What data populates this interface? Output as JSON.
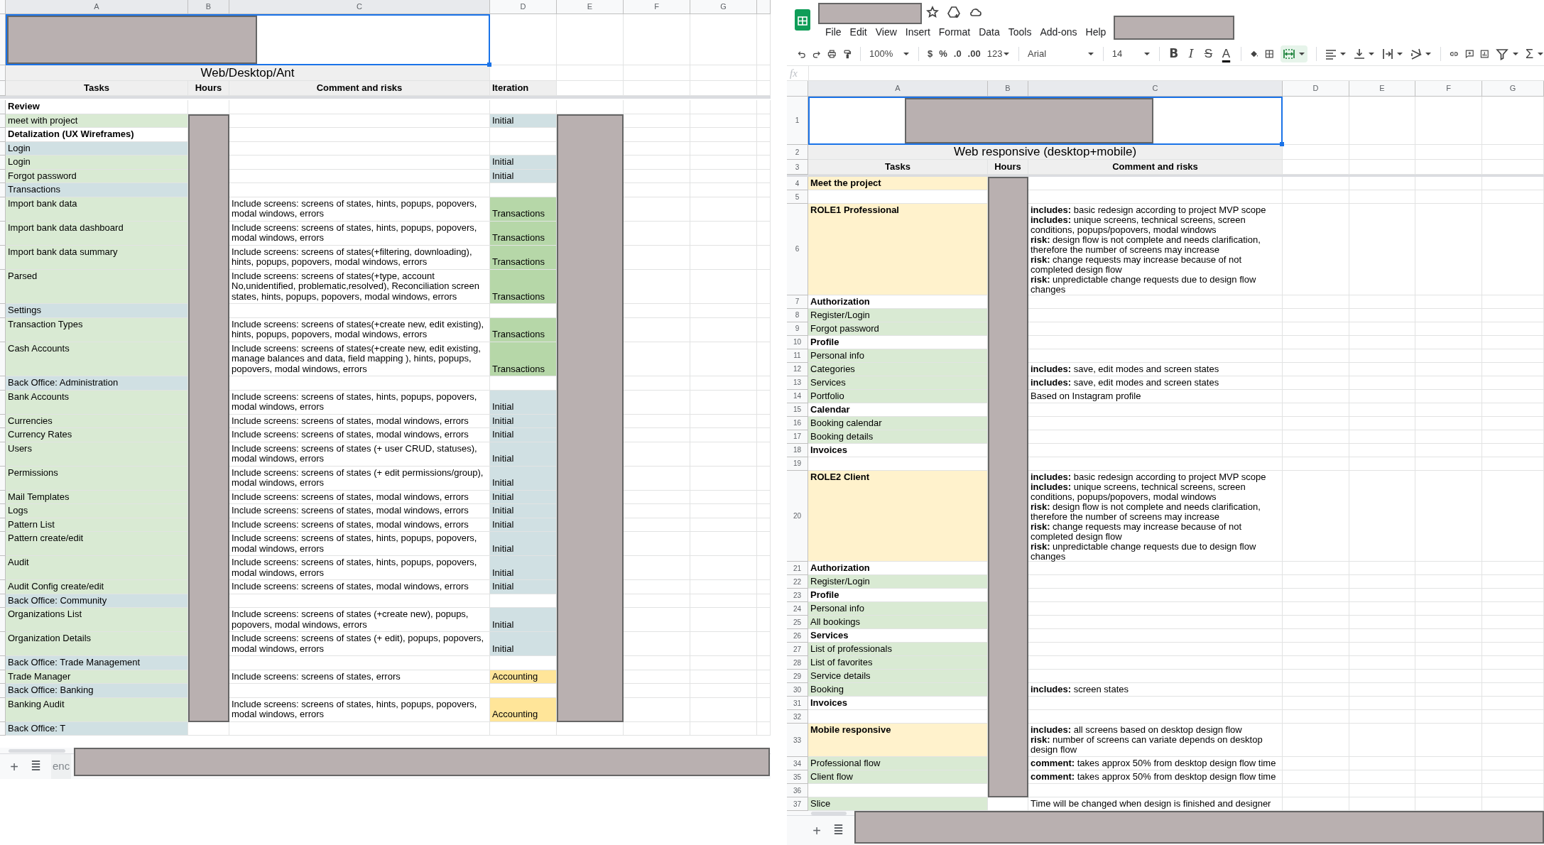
{
  "left_sheet": {
    "column_headers": [
      {
        "label": "A",
        "selected": true
      },
      {
        "label": "B",
        "selected": true
      },
      {
        "label": "C",
        "selected": true
      },
      {
        "label": "D",
        "selected": false
      },
      {
        "label": "E",
        "selected": false
      },
      {
        "label": "F",
        "selected": false
      },
      {
        "label": "G",
        "selected": false
      }
    ],
    "title": "Web/Desktop/Ant",
    "headers": [
      "Tasks",
      "Hours",
      "Comment and risks",
      "Iteration"
    ],
    "rows": [
      {
        "task": "Review",
        "kind": "heading"
      },
      {
        "task": "meet with project",
        "kind": "item",
        "iteration": {
          "label": "Initial",
          "color": "#d0e0e3"
        }
      },
      {
        "task": "Detalization (UX Wireframes)",
        "kind": "heading"
      },
      {
        "task": "Login",
        "kind": "section"
      },
      {
        "task": "Login",
        "kind": "item",
        "iteration": {
          "label": "Initial",
          "color": "#d0e0e3"
        }
      },
      {
        "task": "Forgot password",
        "kind": "item",
        "iteration": {
          "label": "Initial",
          "color": "#d0e0e3"
        }
      },
      {
        "task": "Transactions",
        "kind": "section"
      },
      {
        "task": "Import bank data",
        "kind": "item",
        "comment": "Include screens: screens of states, hints, popups, popovers, modal windows, errors",
        "iteration": {
          "label": "Transactions",
          "color": "#b6d7a8"
        }
      },
      {
        "task": "Import bank data dashboard",
        "kind": "item",
        "comment": "Include screens: screens of states, hints, popups, popovers, modal windows, errors",
        "iteration": {
          "label": "Transactions",
          "color": "#b6d7a8"
        }
      },
      {
        "task": "Import bank data summary",
        "kind": "item",
        "comment": "Include screens: screens of states(+filtering, downloading), hints, popups, popovers, modal windows, errors",
        "iteration": {
          "label": "Transactions",
          "color": "#b6d7a8"
        }
      },
      {
        "task": "Parsed",
        "kind": "item",
        "comment": "Include screens: screens of states(+type, account No,unidentified, problematic,resolved), Reconciliation screen states, hints, popups, popovers, modal windows, errors",
        "iteration": {
          "label": "Transactions",
          "color": "#b6d7a8"
        }
      },
      {
        "task": "Settings",
        "kind": "section"
      },
      {
        "task": "Transaction Types",
        "kind": "item",
        "comment": "Include screens: screens of states(+create new, edit existing), hints, popups, popovers, modal windows, errors",
        "iteration": {
          "label": "Transactions",
          "color": "#b6d7a8"
        }
      },
      {
        "task": "Cash Accounts",
        "kind": "item",
        "comment": "Include screens: screens of states(+create new, edit existing, manage balances and data, field mapping ), hints, popups, popovers, modal windows, errors",
        "iteration": {
          "label": "Transactions",
          "color": "#b6d7a8"
        }
      },
      {
        "task": "Back Office: Administration",
        "kind": "section"
      },
      {
        "task": "Bank Accounts",
        "kind": "item",
        "comment": "Include screens: screens of states, hints, popups, popovers, modal windows, errors",
        "iteration": {
          "label": "Initial",
          "color": "#d0e0e3"
        }
      },
      {
        "task": "Currencies",
        "kind": "item",
        "comment": "Include screens: screens of states, modal windows, errors",
        "iteration": {
          "label": "Initial",
          "color": "#d0e0e3"
        }
      },
      {
        "task": "Currency Rates",
        "kind": "item",
        "comment": "Include screens: screens of states, modal windows, errors",
        "iteration": {
          "label": "Initial",
          "color": "#d0e0e3"
        }
      },
      {
        "task": "Users",
        "kind": "item",
        "comment": "Include screens: screens of states (+ user CRUD, statuses), modal windows, errors",
        "iteration": {
          "label": "Initial",
          "color": "#d0e0e3"
        }
      },
      {
        "task": "Permissions",
        "kind": "item",
        "comment": "Include screens: screens of states (+ edit permissions/group), modal windows, errors",
        "iteration": {
          "label": "Initial",
          "color": "#d0e0e3"
        }
      },
      {
        "task": "Mail Templates",
        "kind": "item",
        "comment": "Include screens: screens of states, modal windows, errors",
        "iteration": {
          "label": "Initial",
          "color": "#d0e0e3"
        }
      },
      {
        "task": "Logs",
        "kind": "item",
        "comment": "Include screens: screens of states, modal windows, errors",
        "iteration": {
          "label": "Initial",
          "color": "#d0e0e3"
        }
      },
      {
        "task": "Pattern List",
        "kind": "item",
        "comment": "Include screens: screens of states, modal windows, errors",
        "iteration": {
          "label": "Initial",
          "color": "#d0e0e3"
        }
      },
      {
        "task": "Pattern create/edit",
        "kind": "item",
        "comment": "Include screens: screens of states, hints, popups, popovers, modal windows, errors",
        "iteration": {
          "label": "Initial",
          "color": "#d0e0e3"
        }
      },
      {
        "task": "Audit",
        "kind": "item",
        "comment": "Include screens: screens of states, hints, popups, popovers, modal windows, errors",
        "iteration": {
          "label": "Initial",
          "color": "#d0e0e3"
        }
      },
      {
        "task": "Audit Config create/edit",
        "kind": "item",
        "comment": "Include screens: screens of states, modal windows, errors",
        "iteration": {
          "label": "Initial",
          "color": "#d0e0e3"
        }
      },
      {
        "task": "Back Office: Community",
        "kind": "section"
      },
      {
        "task": "Organizations List",
        "kind": "item",
        "comment": "Include screens: screens of states (+create new), popups, popovers, modal windows, errors",
        "iteration": {
          "label": "Initial",
          "color": "#d0e0e3"
        }
      },
      {
        "task": "Organization Details",
        "kind": "item",
        "comment": "Include screens: screens of states (+ edit), popups, popovers, modal windows, errors",
        "iteration": {
          "label": "Initial",
          "color": "#d0e0e3"
        }
      },
      {
        "task": "Back Office: Trade Management",
        "kind": "section"
      },
      {
        "task": "Trade Manager",
        "kind": "item",
        "comment": "Include screens: screens of states, errors",
        "iteration": {
          "label": "Accounting",
          "color": "#ffe599"
        }
      },
      {
        "task": "Back Office: Banking",
        "kind": "section"
      },
      {
        "task": "Banking Audit",
        "kind": "item",
        "comment": "Include screens: screens of states, hints, popups, popovers, modal windows, errors",
        "iteration": {
          "label": "Accounting",
          "color": "#ffe599"
        }
      },
      {
        "task": "Back Office: T",
        "kind": "section"
      }
    ],
    "tab_bar": {
      "add": "+",
      "list": "≣",
      "sheet_tab": "enc"
    }
  },
  "right_sheet": {
    "menu": [
      "File",
      "Edit",
      "View",
      "Insert",
      "Format",
      "Data",
      "Tools",
      "Add-ons",
      "Help"
    ],
    "toolbar": {
      "zoom": "100%",
      "currency": "$",
      "percent": "%",
      "decrease_decimals": ".0",
      "increase_decimals": ".00",
      "more_formats": "123",
      "font": "Arial",
      "font_size": "14",
      "bold": "B",
      "italic": "I",
      "strikethrough": "S",
      "text_color": "A",
      "merge_active": true,
      "functions": "Σ"
    },
    "formula_label": "fx",
    "column_headers": [
      {
        "label": "A",
        "selected": true
      },
      {
        "label": "B",
        "selected": true
      },
      {
        "label": "C",
        "selected": true
      },
      {
        "label": "D",
        "selected": false
      },
      {
        "label": "E",
        "selected": false
      },
      {
        "label": "F",
        "selected": false
      },
      {
        "label": "G",
        "selected": false
      }
    ],
    "top_row_numbers": [
      "1",
      "2",
      "3"
    ],
    "title": "Web responsive (desktop+mobile)",
    "headers": [
      "Tasks",
      "Hours",
      "Comment and risks"
    ],
    "rows": [
      {
        "number": "4",
        "task": "Meet the project",
        "kind": "role"
      },
      {
        "number": "5",
        "kind": "empty"
      },
      {
        "number": "6",
        "task": "ROLE1 Professional",
        "kind": "role",
        "comment_lines": [
          "**includes:** basic redesign according to project MVP scope",
          "**includes:** unique screens, technical screens, screen conditions, popups/popovers, modal windows",
          "**risk:** design flow is not complete and needs clarification, therefore the number of screens may increase",
          "**risk:** change requests may increase because of not completed design flow",
          "**risk:** unpredictable change requests due to design flow changes"
        ]
      },
      {
        "number": "7",
        "task": "Authorization",
        "kind": "heading"
      },
      {
        "number": "8",
        "task": "Register/Login",
        "kind": "item"
      },
      {
        "number": "9",
        "task": "Forgot password",
        "kind": "item"
      },
      {
        "number": "10",
        "task": "Profile",
        "kind": "heading"
      },
      {
        "number": "11",
        "task": "Personal info",
        "kind": "item"
      },
      {
        "number": "12",
        "task": "Categories",
        "kind": "item",
        "comment_lines": [
          "**includes:** save, edit modes and screen states"
        ]
      },
      {
        "number": "13",
        "task": "Services",
        "kind": "item",
        "comment_lines": [
          "**includes:** save, edit modes and screen states"
        ]
      },
      {
        "number": "14",
        "task": "Portfolio",
        "kind": "item",
        "comment_lines": [
          "Based on Instagram profile"
        ]
      },
      {
        "number": "15",
        "task": "Calendar",
        "kind": "heading"
      },
      {
        "number": "16",
        "task": "Booking calendar",
        "kind": "item"
      },
      {
        "number": "17",
        "task": "Booking details",
        "kind": "item"
      },
      {
        "number": "18",
        "task": "Invoices",
        "kind": "heading"
      },
      {
        "number": "19",
        "kind": "empty"
      },
      {
        "number": "20",
        "task": "ROLE2 Client",
        "kind": "role",
        "comment_lines": [
          "**includes:** basic redesign according to project MVP scope",
          "**includes:** unique screens, technical screens, screen conditions, popups/popovers, modal windows",
          "**risk:** design flow is not complete and needs clarification, therefore the number of screens may increase",
          "**risk:** change requests may increase because of not completed design flow",
          "**risk:** unpredictable change requests due to design flow changes"
        ]
      },
      {
        "number": "21",
        "task": "Authorization",
        "kind": "heading"
      },
      {
        "number": "22",
        "task": "Register/Login",
        "kind": "item"
      },
      {
        "number": "23",
        "task": "Profile",
        "kind": "heading"
      },
      {
        "number": "24",
        "task": "Personal info",
        "kind": "item"
      },
      {
        "number": "25",
        "task": "All bookings",
        "kind": "item"
      },
      {
        "number": "26",
        "task": "Services",
        "kind": "heading"
      },
      {
        "number": "27",
        "task": "List of professionals",
        "kind": "item"
      },
      {
        "number": "28",
        "task": "List of favorites",
        "kind": "item"
      },
      {
        "number": "29",
        "task": "Service details",
        "kind": "item"
      },
      {
        "number": "30",
        "task": "Booking",
        "kind": "item",
        "comment_lines": [
          "**includes:** screen states"
        ]
      },
      {
        "number": "31",
        "task": "Invoices",
        "kind": "heading"
      },
      {
        "number": "32",
        "kind": "empty"
      },
      {
        "number": "33",
        "task": "Mobile responsive",
        "kind": "role",
        "comment_lines": [
          "**includes:** all screens based on desktop design flow",
          "**risk:** number of screens can variate depends on desktop design flow"
        ]
      },
      {
        "number": "34",
        "task": "Professional flow",
        "kind": "item",
        "comment_lines": [
          "**comment:** takes approx 50% from desktop design flow time"
        ]
      },
      {
        "number": "35",
        "task": "Client flow",
        "kind": "item",
        "comment_lines": [
          "**comment:** takes approx 50% from desktop design flow time"
        ]
      },
      {
        "number": "36",
        "kind": "empty"
      },
      {
        "number": "37",
        "task": "Slice",
        "kind": "item",
        "comment_lines": [
          "Time will be changed when design is finished and designer"
        ]
      }
    ],
    "tab_bar": {
      "add": "+",
      "list": "≣"
    }
  }
}
